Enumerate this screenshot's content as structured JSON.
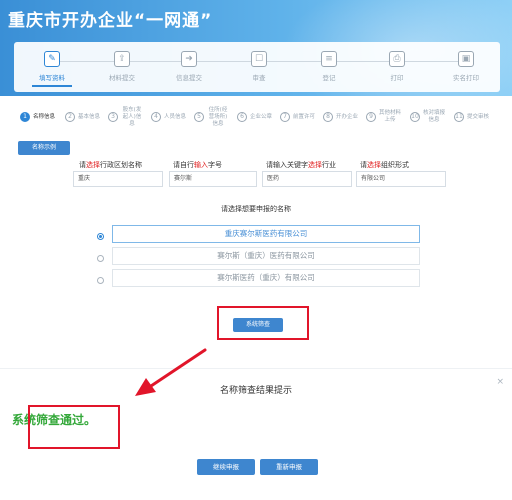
{
  "header": {
    "title": "重庆市开办企业“一网通”"
  },
  "steps": [
    {
      "label": "填写资料",
      "icon": "edit-icon",
      "active": true
    },
    {
      "label": "材料提交",
      "icon": "upload-icon",
      "active": false
    },
    {
      "label": "信息提交",
      "icon": "submit-icon",
      "active": false
    },
    {
      "label": "审查",
      "icon": "review-icon",
      "active": false
    },
    {
      "label": "登记",
      "icon": "register-icon",
      "active": false
    },
    {
      "label": "打印",
      "icon": "print-icon",
      "active": false
    },
    {
      "label": "实名打印",
      "icon": "id-print-icon",
      "active": false
    }
  ],
  "substeps": [
    {
      "num": "1",
      "label": "名称信息",
      "active": true
    },
    {
      "num": "2",
      "label": "基本信息",
      "active": false
    },
    {
      "num": "3",
      "label": "股东(发起人)信息",
      "active": false
    },
    {
      "num": "4",
      "label": "人员信息",
      "active": false
    },
    {
      "num": "5",
      "label": "住所(经营场所)信息",
      "active": false
    },
    {
      "num": "6",
      "label": "企业公章",
      "active": false
    },
    {
      "num": "7",
      "label": "前置许可",
      "active": false
    },
    {
      "num": "8",
      "label": "开办企业",
      "active": false
    },
    {
      "num": "9",
      "label": "其他材料上传",
      "active": false
    },
    {
      "num": "10",
      "label": "核对填报信息",
      "active": false
    },
    {
      "num": "11",
      "label": "提交审核",
      "active": false
    }
  ],
  "name_example_button": "名称示例",
  "fields": {
    "region": {
      "label_pre": "请",
      "label_red": "选择",
      "label_post": "行政区划名称",
      "value": "重庆"
    },
    "trade_name": {
      "label_pre": "请自行",
      "label_red": "输入",
      "label_post": "字号",
      "value": "赛尔斯"
    },
    "industry": {
      "label_pre": "请输入关键字",
      "label_red": "选择",
      "label_post": "行业",
      "value": "医药"
    },
    "org_form": {
      "label_pre": "请",
      "label_red": "选择",
      "label_post": "组织形式",
      "value": "有限公司"
    }
  },
  "choose_prompt": "请选择想要申报的名称",
  "name_options": [
    {
      "text": "重庆赛尔斯医药有限公司",
      "selected": true
    },
    {
      "text": "赛尔斯（重庆）医药有限公司",
      "selected": false
    },
    {
      "text": "赛尔斯医药（重庆）有限公司",
      "selected": false
    }
  ],
  "screen_button": "系统筛查",
  "modal": {
    "title": "名称筛查结果提示",
    "close": "×",
    "result": "系统筛查通过。",
    "continue_button": "继续申报",
    "reapply_button": "重新申报"
  },
  "colors": {
    "accent": "#3e86cf",
    "highlight": "#e1152a",
    "success": "#34a83a"
  }
}
